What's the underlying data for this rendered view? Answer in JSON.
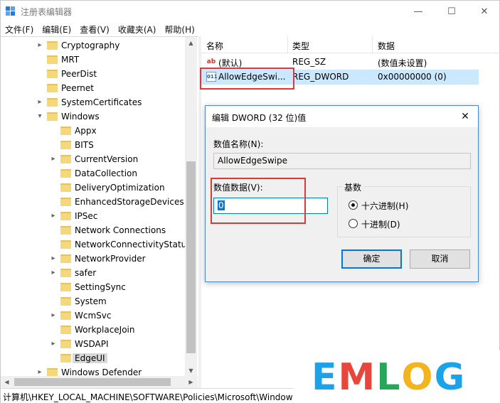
{
  "window": {
    "title": "注册表编辑器",
    "min_glyph": "—",
    "max_glyph": "☐",
    "close_glyph": "✕"
  },
  "menu": [
    "文件(F)",
    "编辑(E)",
    "查看(V)",
    "收藏夹(A)",
    "帮助(H)"
  ],
  "tree": {
    "items": [
      {
        "label": "Cryptography",
        "level": 1,
        "expander": "▸"
      },
      {
        "label": "MRT",
        "level": 1,
        "expander": ""
      },
      {
        "label": "PeerDist",
        "level": 1,
        "expander": ""
      },
      {
        "label": "Peernet",
        "level": 1,
        "expander": ""
      },
      {
        "label": "SystemCertificates",
        "level": 1,
        "expander": "▸"
      },
      {
        "label": "Windows",
        "level": 1,
        "expander": "▾"
      },
      {
        "label": "Appx",
        "level": 2,
        "expander": ""
      },
      {
        "label": "BITS",
        "level": 2,
        "expander": ""
      },
      {
        "label": "CurrentVersion",
        "level": 2,
        "expander": "▸"
      },
      {
        "label": "DataCollection",
        "level": 2,
        "expander": ""
      },
      {
        "label": "DeliveryOptimization",
        "level": 2,
        "expander": ""
      },
      {
        "label": "EnhancedStorageDevices",
        "level": 2,
        "expander": ""
      },
      {
        "label": "IPSec",
        "level": 2,
        "expander": "▸"
      },
      {
        "label": "Network Connections",
        "level": 2,
        "expander": ""
      },
      {
        "label": "NetworkConnectivityStatus",
        "level": 2,
        "expander": ""
      },
      {
        "label": "NetworkProvider",
        "level": 2,
        "expander": "▸"
      },
      {
        "label": "safer",
        "level": 2,
        "expander": "▸"
      },
      {
        "label": "SettingSync",
        "level": 2,
        "expander": ""
      },
      {
        "label": "System",
        "level": 2,
        "expander": ""
      },
      {
        "label": "WcmSvc",
        "level": 2,
        "expander": "▸"
      },
      {
        "label": "WorkplaceJoin",
        "level": 2,
        "expander": ""
      },
      {
        "label": "WSDAPI",
        "level": 2,
        "expander": "▸"
      },
      {
        "label": "EdgeUI",
        "level": 2,
        "expander": "",
        "selected": true
      },
      {
        "label": "Windows Defender",
        "level": 1,
        "expander": "▸"
      }
    ]
  },
  "list": {
    "columns": [
      "名称",
      "类型",
      "数据"
    ],
    "rows": [
      {
        "icon": "ab",
        "name": "(默认)",
        "type": "REG_SZ",
        "data": "(数值未设置)",
        "selected": false
      },
      {
        "icon": "011",
        "name": "AllowEdgeSwi...",
        "type": "REG_DWORD",
        "data": "0x00000000 (0)",
        "selected": true
      }
    ]
  },
  "status": {
    "path": "计算机\\HKEY_LOCAL_MACHINE\\SOFTWARE\\Policies\\Microsoft\\Windows\\EdgeUI"
  },
  "dialog": {
    "title": "编辑 DWORD (32 位)值",
    "close_glyph": "✕",
    "name_label": "数值名称(N):",
    "name_value": "AllowEdgeSwipe",
    "data_label": "数值数据(V):",
    "data_value": "0",
    "base_label": "基数",
    "radios": [
      {
        "label": "十六进制(H)",
        "checked": true
      },
      {
        "label": "十进制(D)",
        "checked": false
      }
    ],
    "ok_label": "确定",
    "cancel_label": "取消"
  },
  "watermark": {
    "letters": [
      "E",
      "M",
      "L",
      "O",
      "G"
    ],
    "colors": [
      "#1aa3e8",
      "#e8453c",
      "#26a65b",
      "#f2b51f",
      "#1aa3e8"
    ]
  },
  "colors": {
    "highlight_red": "#e0373b",
    "selection_blue": "#cce8ff",
    "accent": "#0078d7"
  }
}
